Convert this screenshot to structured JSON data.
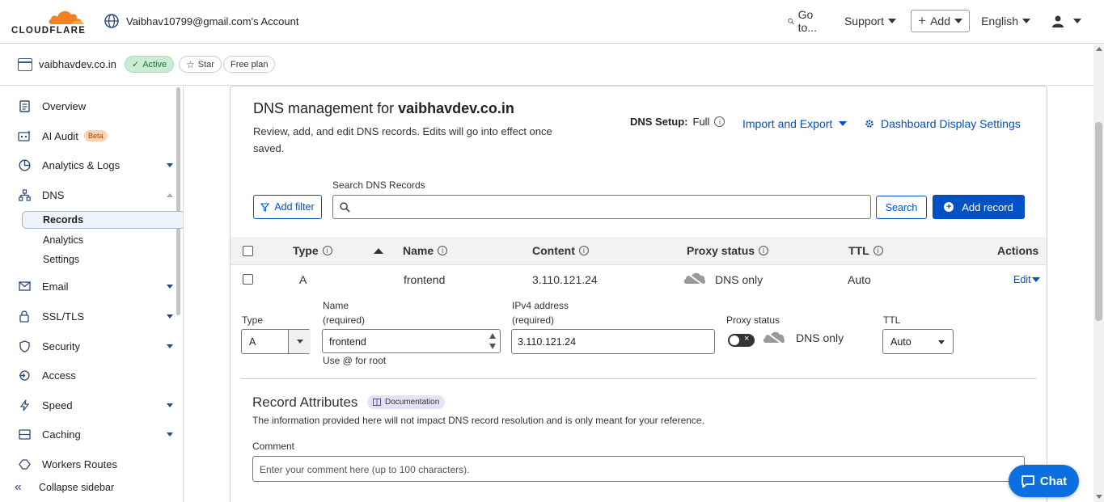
{
  "topbar": {
    "logo_text": "CLOUDFLARE",
    "account": "Vaibhav10799@gmail.com's Account",
    "goto": "Go to...",
    "support": "Support",
    "add": "Add",
    "language": "English",
    "icons": [
      "globe-icon",
      "search-icon",
      "user-icon"
    ]
  },
  "zone": {
    "name": "vaibhavdev.co.in",
    "status": "Active",
    "star": "Star",
    "plan": "Free plan"
  },
  "sidebar": {
    "items": [
      {
        "label": "Overview",
        "icon": "document-icon"
      },
      {
        "label": "AI Audit",
        "icon": "ai-audit-icon",
        "badge": "Beta"
      },
      {
        "label": "Analytics & Logs",
        "icon": "analytics-icon"
      },
      {
        "label": "DNS",
        "icon": "dns-icon"
      },
      {
        "label": "Email",
        "icon": "email-icon"
      },
      {
        "label": "SSL/TLS",
        "icon": "lock-icon"
      },
      {
        "label": "Security",
        "icon": "shield-icon"
      },
      {
        "label": "Access",
        "icon": "access-icon"
      },
      {
        "label": "Speed",
        "icon": "bolt-icon"
      },
      {
        "label": "Caching",
        "icon": "caching-icon"
      },
      {
        "label": "Workers Routes",
        "icon": "workers-icon"
      }
    ],
    "dns_sub": [
      "Records",
      "Analytics",
      "Settings"
    ],
    "collapse": "Collapse sidebar"
  },
  "main": {
    "title_prefix": "DNS management for",
    "title_domain": "vaibhavdev.co.in",
    "description": "Review, add, and edit DNS records. Edits will go into effect once saved.",
    "dns_setup_label": "DNS Setup:",
    "dns_setup_value": "Full",
    "import_export": "Import and Export",
    "dashboard_settings": "Dashboard Display Settings",
    "add_filter": "Add filter",
    "search_label": "Search DNS Records",
    "search_placeholder": "",
    "search_button": "Search",
    "add_record": "Add record",
    "columns": {
      "type": "Type",
      "name": "Name",
      "content": "Content",
      "proxy": "Proxy status",
      "ttl": "TTL",
      "actions": "Actions"
    },
    "record": {
      "type": "A",
      "name": "frontend",
      "content": "3.110.121.24",
      "proxy": "DNS only",
      "ttl": "Auto",
      "edit": "Edit"
    },
    "form": {
      "type_label": "Type",
      "type_value": "A",
      "name_label": "Name",
      "name_required": "(required)",
      "name_value": "frontend",
      "name_hint": "Use @ for root",
      "ipv4_label": "IPv4 address",
      "ipv4_required": "(required)",
      "ipv4_value": "3.110.121.24",
      "proxy_label": "Proxy status",
      "proxy_value": "DNS only",
      "ttl_label": "TTL",
      "ttl_value": "Auto"
    },
    "attributes": {
      "title": "Record Attributes",
      "doc": "Documentation",
      "description": "The information provided here will not impact DNS record resolution and is only meant for your reference.",
      "comment_label": "Comment",
      "comment_placeholder": "Enter your comment here (up to 100 characters)."
    }
  },
  "chat": "Chat",
  "colors": {
    "accent": "#0051c3",
    "brand_orange": "#f48120",
    "active_green": "#c8ecd4"
  }
}
